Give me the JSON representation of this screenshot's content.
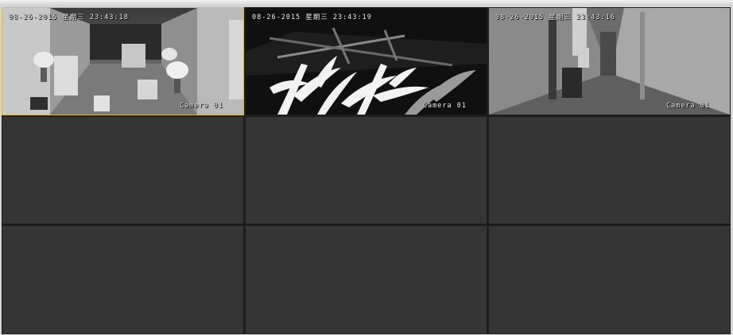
{
  "window": {
    "accent": "#d8b84a",
    "empty_tile_color": "#353535"
  },
  "tiles": [
    {
      "timestamp": "08-26-2015 星期三 23:43:18",
      "camera_label": "Camera 01",
      "state": "live",
      "selected": true
    },
    {
      "timestamp": "08-26-2015 星期三 23:43:19",
      "camera_label": "Camera 01",
      "state": "live",
      "selected": false
    },
    {
      "timestamp": "08-26-2015 星期三 23:43:16",
      "camera_label": "Camera 01",
      "state": "live",
      "selected": false
    },
    {
      "state": "empty"
    },
    {
      "state": "empty"
    },
    {
      "state": "empty"
    },
    {
      "state": "empty"
    },
    {
      "state": "empty"
    },
    {
      "state": "empty"
    }
  ]
}
